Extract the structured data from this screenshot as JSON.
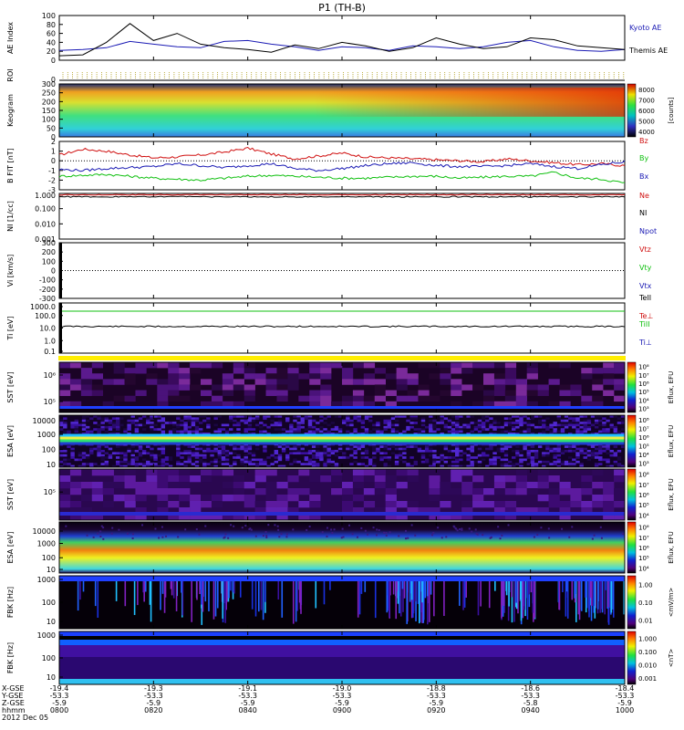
{
  "title": "P1 (TH-B)",
  "time_axis": {
    "ticks": [
      "0800",
      "0820",
      "0840",
      "0900",
      "0920",
      "0940",
      "1000"
    ],
    "row_labels": [
      "X-GSE",
      "Y-GSE",
      "Z-GSE",
      "hhmm",
      "2012 Dec 05"
    ],
    "x_gse": [
      "-19.4",
      "-19.3",
      "-19.1",
      "-19.0",
      "-18.8",
      "-18.6",
      "-18.4"
    ],
    "y_gse": [
      "-53.3",
      "-53.3",
      "-53.3",
      "-53.3",
      "-53.3",
      "-53.3",
      "-53.3"
    ],
    "z_gse": [
      "-5.9",
      "-5.9",
      "-5.9",
      "-5.9",
      "-5.9",
      "-5.8",
      "-5.9"
    ]
  },
  "colors": {
    "black": "#000000",
    "blue": "#1a1ab4",
    "red": "#d01010",
    "green": "#10c010",
    "yellow": "#ffee00",
    "orange": "#ff6a00",
    "dark_purple": "#1b0326",
    "purple": "#3c0a72"
  },
  "chart_data": [
    {
      "type": "line",
      "id": "ae",
      "ylabel": "AE Index",
      "ylim": [
        0,
        100
      ],
      "yticks": [
        "0",
        "20",
        "40",
        "60",
        "80",
        "100"
      ],
      "x": [
        0,
        5,
        10,
        15,
        20,
        25,
        30,
        35,
        40,
        45,
        50,
        55,
        60,
        65,
        70,
        75,
        80,
        85,
        90,
        95,
        100,
        105,
        110,
        115,
        120
      ],
      "series": [
        {
          "name": "Kyoto AE",
          "color": "#1a1ab4",
          "values": [
            22,
            24,
            28,
            42,
            36,
            30,
            28,
            42,
            44,
            36,
            30,
            22,
            30,
            28,
            22,
            32,
            30,
            26,
            30,
            40,
            44,
            30,
            22,
            20,
            24
          ]
        },
        {
          "name": "Themis AE",
          "color": "#000000",
          "values": [
            10,
            12,
            40,
            82,
            44,
            60,
            36,
            28,
            24,
            18,
            34,
            26,
            40,
            32,
            20,
            28,
            50,
            36,
            26,
            30,
            50,
            46,
            32,
            28,
            24
          ]
        }
      ]
    },
    {
      "type": "heatmap",
      "id": "roi",
      "ylabel": "ROI",
      "yticks": [
        "0"
      ]
    },
    {
      "type": "heatmap",
      "id": "keogram",
      "ylabel": "Keogram",
      "yticks": [
        "0",
        "50",
        "100",
        "150",
        "200",
        "250",
        "300"
      ],
      "colorbar": {
        "label": "[counts]",
        "ticks": [
          "4000",
          "5000",
          "6000",
          "7000",
          "8000"
        ]
      }
    },
    {
      "type": "line",
      "id": "bfield",
      "ylabel": "B FIT [nT]",
      "ylim": [
        -3,
        2
      ],
      "yticks": [
        "-3",
        "-2",
        "-1",
        "0",
        "1",
        "2"
      ],
      "series": [
        {
          "name": "Bz",
          "color": "#d01010",
          "values": [
            0.6,
            1.2,
            1.0,
            0.6,
            0.3,
            0.4,
            0.6,
            0.9,
            1.3,
            0.7,
            0.2,
            0.5,
            0.8,
            0.4,
            0.3,
            0.2,
            0.1,
            0.0,
            -0.1,
            0.2,
            0.0,
            -0.2,
            -0.4,
            -0.3,
            -0.5
          ]
        },
        {
          "name": "By",
          "color": "#10c010",
          "values": [
            -1.6,
            -1.5,
            -1.4,
            -1.6,
            -1.8,
            -1.9,
            -2.0,
            -1.8,
            -1.6,
            -1.5,
            -1.6,
            -1.7,
            -1.8,
            -1.8,
            -1.7,
            -1.6,
            -1.6,
            -1.8,
            -1.7,
            -1.6,
            -1.6,
            -1.2,
            -1.8,
            -1.9,
            -2.3
          ]
        },
        {
          "name": "Bx",
          "color": "#1a1ab4",
          "values": [
            -0.9,
            -1.0,
            -0.8,
            -0.7,
            -0.6,
            -0.3,
            -0.5,
            -0.7,
            -0.5,
            -0.3,
            -0.8,
            -1.0,
            -0.8,
            -0.5,
            -0.3,
            -0.2,
            -0.5,
            -0.6,
            -0.6,
            -0.5,
            -0.3,
            -0.6,
            -0.8,
            -0.4,
            -0.1
          ]
        }
      ]
    },
    {
      "type": "line",
      "id": "density",
      "ylabel": "NI [1/cc]",
      "yticks": [
        "0.001",
        "0.010",
        "0.100",
        "1.000"
      ],
      "legend": [
        "Ne",
        "NI",
        "Npot"
      ]
    },
    {
      "type": "line",
      "id": "velocity",
      "ylabel": "Vi [km/s]",
      "ylim": [
        -300,
        300
      ],
      "yticks": [
        "-300",
        "-200",
        "-100",
        "0",
        "100",
        "200",
        "300"
      ],
      "legend": [
        "Vtz",
        "Vty",
        "Vtx"
      ]
    },
    {
      "type": "line",
      "id": "temperature",
      "ylabel": "Ti [eV]",
      "yticks": [
        "0.1",
        "1.0",
        "10.0",
        "100.0",
        "1000.0"
      ],
      "legend": [
        "TeII",
        "Te⊥",
        "TiII",
        "Ti⊥"
      ]
    },
    {
      "type": "heatmap",
      "id": "sst_e",
      "ylabel": "SST [eV]",
      "yticks": [
        "10⁵",
        "10⁶"
      ],
      "colorbar": {
        "label": "Eflux, EFU",
        "ticks": [
          "10³",
          "10⁴",
          "10⁵",
          "10⁶",
          "10⁷",
          "10⁸"
        ]
      }
    },
    {
      "type": "heatmap",
      "id": "esa_e",
      "ylabel": "ESA [eV]",
      "yticks": [
        "10",
        "100",
        "1000",
        "10000"
      ],
      "colorbar": {
        "label": "Eflux, EFU",
        "ticks": [
          "10³",
          "10⁴",
          "10⁵",
          "10⁶",
          "10⁷",
          "10⁸"
        ]
      }
    },
    {
      "type": "heatmap",
      "id": "sst_i",
      "ylabel": "SST [eV]",
      "yticks": [
        "10⁵"
      ],
      "colorbar": {
        "label": "Eflux, EFU",
        "ticks": [
          "10⁴",
          "10⁵",
          "10⁶",
          "10⁷",
          "10⁸"
        ]
      }
    },
    {
      "type": "heatmap",
      "id": "esa_i",
      "ylabel": "ESA [eV]",
      "yticks": [
        "10",
        "100",
        "1000",
        "10000"
      ],
      "colorbar": {
        "label": "Eflux, EFU",
        "ticks": [
          "10⁴",
          "10⁵",
          "10⁶",
          "10⁷",
          "10⁸"
        ]
      }
    },
    {
      "type": "heatmap",
      "id": "fbk_e",
      "ylabel": "FBK [Hz]",
      "yticks": [
        "10",
        "100",
        "1000"
      ],
      "colorbar": {
        "label": "<mV/m>",
        "ticks": [
          "0.01",
          "0.10",
          "1.00"
        ]
      }
    },
    {
      "type": "heatmap",
      "id": "fbk_b",
      "ylabel": "FBK [Hz]",
      "yticks": [
        "10",
        "100",
        "1000"
      ],
      "colorbar": {
        "label": "<nT>",
        "ticks": [
          "0.001",
          "0.010",
          "0.100",
          "1.000"
        ]
      }
    }
  ]
}
